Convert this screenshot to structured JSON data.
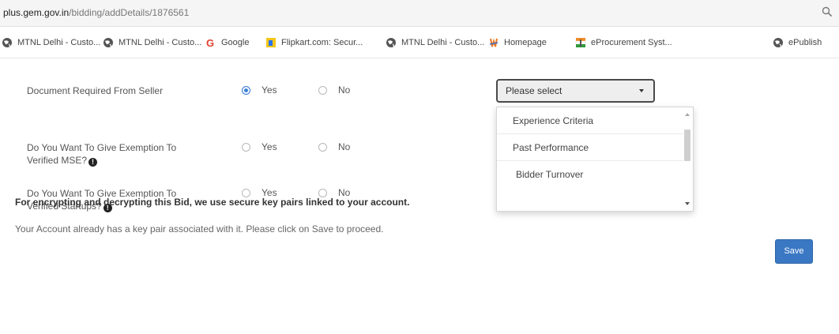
{
  "address_bar": {
    "host": "plus.gem.gov.in",
    "path": "/bidding/addDetails/1876561"
  },
  "bookmarks": [
    {
      "label": "MTNL Delhi - Custo...",
      "icon": "globe-icon"
    },
    {
      "label": "MTNL Delhi - Custo...",
      "icon": "globe-icon"
    },
    {
      "label": "Google",
      "icon": "google-icon"
    },
    {
      "label": "Flipkart.com: Secur...",
      "icon": "flipkart-icon"
    },
    {
      "label": "MTNL Delhi - Custo...",
      "icon": "globe-icon"
    },
    {
      "label": "Homepage",
      "icon": "homepage-icon"
    },
    {
      "label": "eProcurement Syst...",
      "icon": "eprocurement-icon"
    },
    {
      "label": "ePublish",
      "icon": "globe-icon"
    }
  ],
  "form": {
    "rows": [
      {
        "label": "Document Required From Seller",
        "yes_label": "Yes",
        "no_label": "No",
        "selected": "Yes"
      },
      {
        "label_line1": "Do You Want To Give Exemption To",
        "label_line2": "Verified MSE?",
        "yes_label": "Yes",
        "no_label": "No",
        "selected": ""
      },
      {
        "label_line1": "Do You Want To Give Exemption To",
        "label_line2": "Verified Startups?",
        "yes_label": "Yes",
        "no_label": "No",
        "selected": ""
      }
    ],
    "document_select": {
      "value": "Please select",
      "options": [
        "Experience Criteria",
        "Past Performance",
        "Bidder Turnover"
      ]
    }
  },
  "encryption": {
    "title": "For encrypting and decrypting this Bid, we use secure key pairs linked to your account.",
    "message": "Your Account already has a key pair associated with it. Please click on Save to proceed."
  },
  "save_label": "Save",
  "colors": {
    "accent": "#3a78c4",
    "radio_checked": "#3d7fd6"
  }
}
